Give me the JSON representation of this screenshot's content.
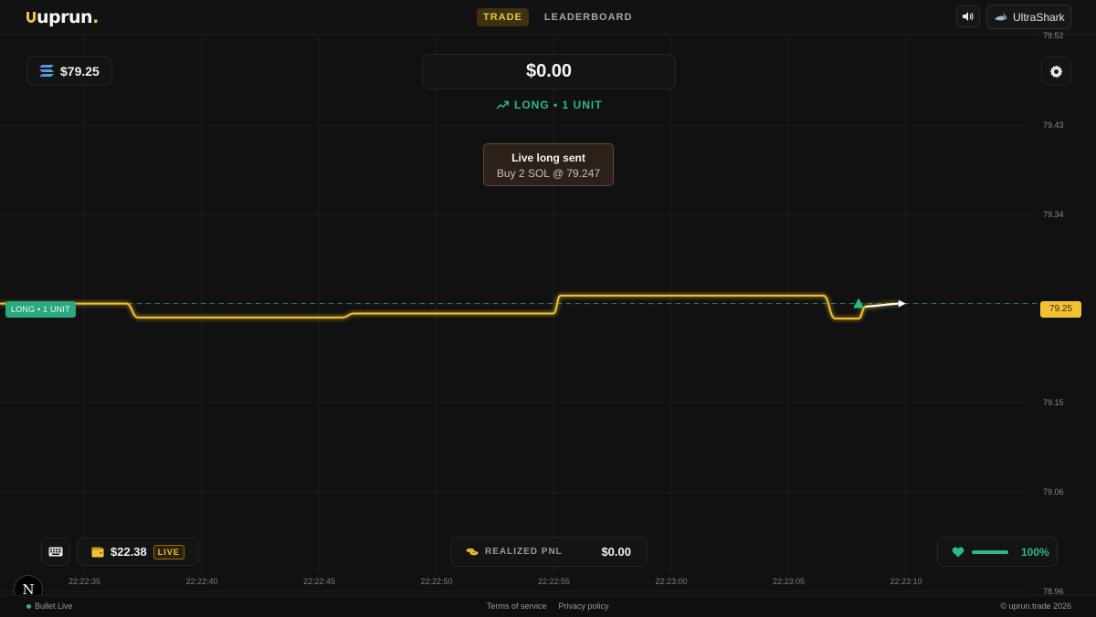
{
  "app": {
    "logo_text": "uprun",
    "logo_dot": "."
  },
  "nav": {
    "tabs": [
      {
        "label": "TRADE",
        "active": true
      },
      {
        "label": "LEADERBOARD",
        "active": false
      }
    ]
  },
  "user": {
    "name": "UltraShark",
    "avatar_icon": "shark-icon"
  },
  "asset": {
    "icon": "solana-icon",
    "price": "$79.25"
  },
  "position": {
    "pnl": "$0.00",
    "label": "LONG • 1 UNIT",
    "icon": "trending-up-icon"
  },
  "toast": {
    "title": "Live long sent",
    "body": "Buy 2 SOL @ 79.247"
  },
  "chart_data": {
    "type": "line",
    "title": "",
    "x_ticks": [
      "22:22:35",
      "22:22:40",
      "22:22:45",
      "22:22:50",
      "22:22:55",
      "22:23:00",
      "22:23:05",
      "22:23:10"
    ],
    "y_ticks": [
      "79.52",
      "79.43",
      "79.34",
      "79.25",
      "79.15",
      "79.06",
      "78.96"
    ],
    "ylim": [
      78.96,
      79.52
    ],
    "series": [
      {
        "values": [
          {
            "t": "22:22:35.0",
            "y": 79.25
          },
          {
            "t": "22:22:36.8",
            "y": 79.25
          },
          {
            "t": "22:22:37.3",
            "y": 79.236
          },
          {
            "t": "22:22:46.0",
            "y": 79.236
          },
          {
            "t": "22:22:46.5",
            "y": 79.24
          },
          {
            "t": "22:22:55.0",
            "y": 79.24
          },
          {
            "t": "22:22:55.3",
            "y": 79.258
          },
          {
            "t": "22:23:06.5",
            "y": 79.258
          },
          {
            "t": "22:23:07.0",
            "y": 79.235
          },
          {
            "t": "22:23:08.0",
            "y": 79.235
          },
          {
            "t": "22:23:08.3",
            "y": 79.247
          },
          {
            "t": "22:23:09.7",
            "y": 79.25
          }
        ]
      }
    ],
    "entry_price": 79.25,
    "entry_marker_time": "22:23:08",
    "current_price_label": "79.25",
    "entry_tag": "LONG • 1 UNIT",
    "colors": {
      "line": "#f2c230",
      "entry_line": "#2bb98b",
      "fill": "#1a1607"
    },
    "grid": true
  },
  "wallet": {
    "balance": "$22.38",
    "badge": "LIVE",
    "icon": "wallet-icon"
  },
  "realized": {
    "label": "REALIZED PNL",
    "value": "$0.00",
    "icon": "coins-icon"
  },
  "health": {
    "value": "100%",
    "fill": 1.0,
    "icon": "heart-icon"
  },
  "footer": {
    "status": "Bullet Live",
    "links": [
      "Terms of service",
      "Privacy policy"
    ],
    "copyright": "© uprun.trade 2026"
  },
  "next_badge": "N"
}
